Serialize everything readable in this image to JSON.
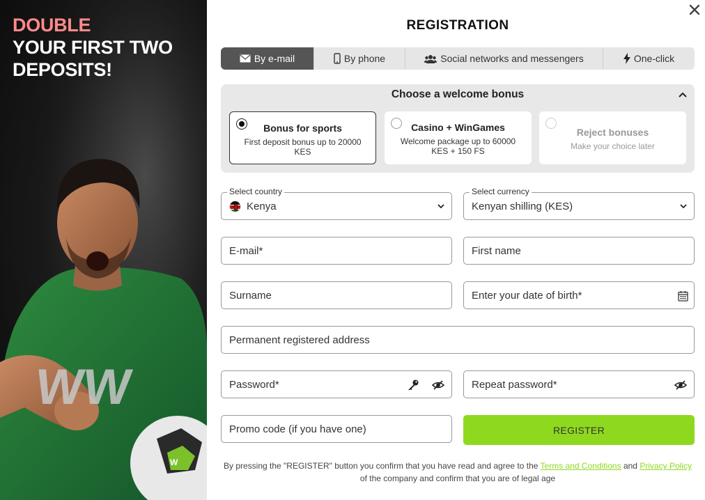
{
  "promo": {
    "line1": "DOUBLE",
    "line2": "YOUR FIRST TWO",
    "line3": "DEPOSITS!",
    "shirt_logo": "WW",
    "accent_color": "#ff8a8a"
  },
  "dialog": {
    "title": "REGISTRATION",
    "close_icon": "close-icon"
  },
  "tabs": [
    {
      "label": "By e-mail",
      "icon": "envelope-icon",
      "active": true
    },
    {
      "label": "By phone",
      "icon": "phone-icon",
      "active": false
    },
    {
      "label": "Social networks and messengers",
      "icon": "users-icon",
      "active": false
    },
    {
      "label": "One-click",
      "icon": "lightning-icon",
      "active": false
    }
  ],
  "bonus": {
    "heading": "Choose a welcome bonus",
    "options": [
      {
        "title": "Bonus for sports",
        "subtitle": "First deposit bonus up to 20000 KES",
        "selected": true
      },
      {
        "title": "Casino + WinGames",
        "subtitle": "Welcome package up to 60000 KES + 150 FS",
        "selected": false
      },
      {
        "title": "Reject bonuses",
        "subtitle": "Make your choice later",
        "selected": false
      }
    ]
  },
  "form": {
    "country": {
      "label": "Select country",
      "value": "Kenya"
    },
    "currency": {
      "label": "Select currency",
      "value": "Kenyan shilling (KES)"
    },
    "email": "E-mail*",
    "first_name": "First name",
    "surname": "Surname",
    "dob": "Enter your date of birth*",
    "address": "Permanent registered address",
    "password": "Password*",
    "repeat_password": "Repeat password*",
    "promo_code": "Promo code (if you have one)"
  },
  "register_button": {
    "label": "REGISTER",
    "color": "#8ed91f"
  },
  "terms": {
    "part1": "By pressing the \"REGISTER\" button you confirm that you have read and agree to the ",
    "link1": "Terms and Conditions",
    "part2": " and ",
    "link2": "Privacy Policy",
    "part3": " of the company and confirm that you are of legal age"
  }
}
